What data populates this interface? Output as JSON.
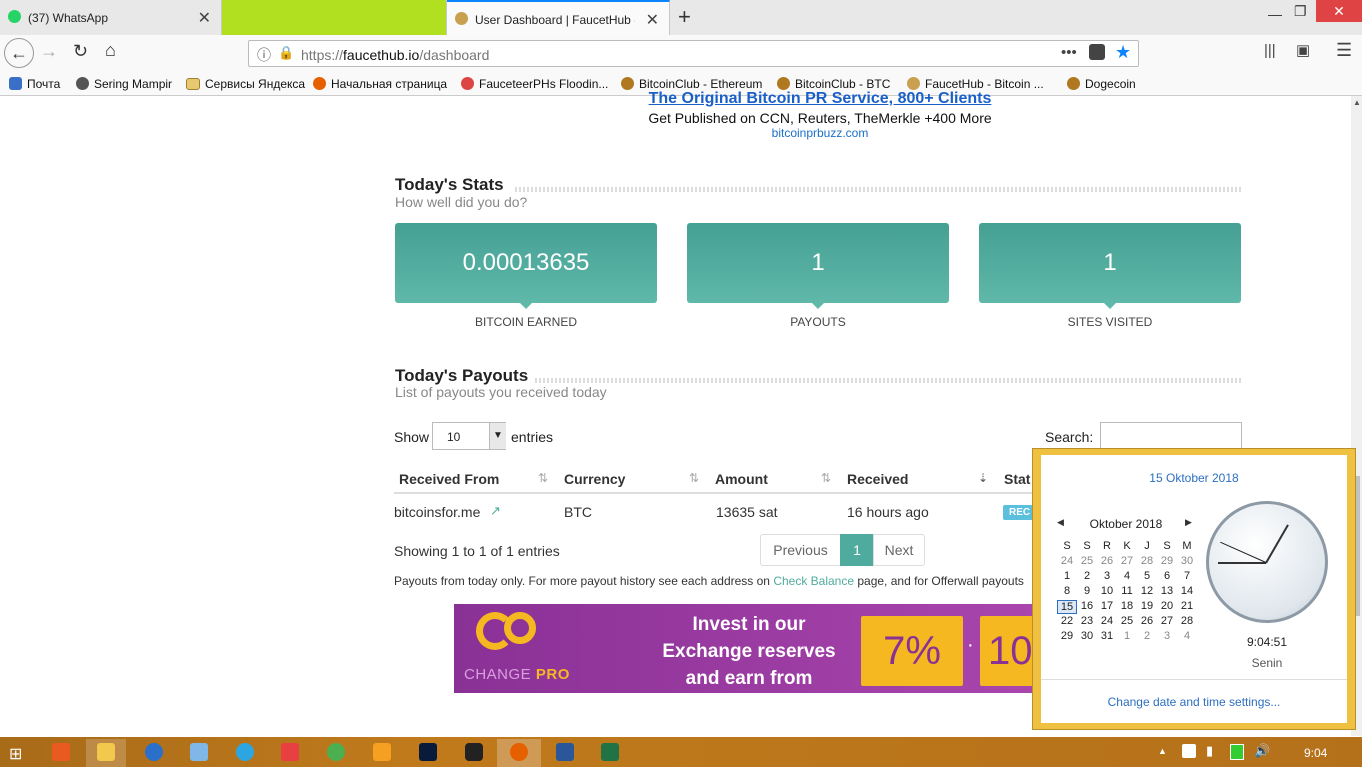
{
  "browser": {
    "tabs": [
      {
        "title": "(37) WhatsApp",
        "favicon": "whatsapp-icon",
        "badge": "37"
      },
      {
        "title": "",
        "favicon": "green-tab-icon"
      },
      {
        "title": "User Dashboard | FaucetHub - I",
        "favicon": "faucethub-icon"
      }
    ],
    "new_tab_symbol": "+",
    "url_prefix": "https://",
    "url_host": "faucethub.io",
    "url_path": "/dashboard",
    "bookmarks": [
      "Почта",
      "Sering Mampir",
      "Сервисы Яндекса",
      "Начальная страница",
      "FauceteerPHs Floodin...",
      "BitcoinClub - Ethereum",
      "BitcoinClub -  BTC",
      "FaucetHub - Bitcoin ...",
      "Dogecoin"
    ]
  },
  "ad_top": {
    "headline": "The Original Bitcoin PR Service, 800+ Clients",
    "text": "Get Published on CCN, Reuters, TheMerkle +400 More",
    "url": "bitcoinprbuzz.com"
  },
  "stats": {
    "title": "Today's Stats",
    "subtitle": "How well did you do?",
    "cards": [
      {
        "value": "0.00013635",
        "label": "BITCOIN EARNED"
      },
      {
        "value": "1",
        "label": "PAYOUTS"
      },
      {
        "value": "1",
        "label": "SITES VISITED"
      }
    ]
  },
  "payouts": {
    "title": "Today's Payouts",
    "subtitle": "List of payouts you received today",
    "show_label": "Show",
    "entries_value": "10",
    "entries_label": "entries",
    "search_label": "Search:",
    "columns": [
      "Received From",
      "Currency",
      "Amount",
      "Received",
      "Stat"
    ],
    "rows": [
      {
        "from": "bitcoinsfor.me",
        "currency": "BTC",
        "amount": "13635 sat",
        "received": "16 hours ago",
        "status": "REC"
      }
    ],
    "info": "Showing 1 to 1 of 1 entries",
    "pagination": {
      "previous": "Previous",
      "current": "1",
      "next": "Next"
    },
    "note_pre": "Payouts from today only. For more payout history see each address on ",
    "note_link": "Check Balance",
    "note_post": " page, and for Offerwall payouts"
  },
  "ad_bottom": {
    "brand_change": "CHANGE",
    "brand_pro": "PRO",
    "line1": "Invest in our",
    "line2": "Exchange reserves",
    "line3": "and earn from",
    "pct1": "7%",
    "pct2": "10"
  },
  "calendar": {
    "date_header": "15 Oktober 2018",
    "month": "Oktober 2018",
    "weekdays": [
      "S",
      "S",
      "R",
      "K",
      "J",
      "S",
      "M"
    ],
    "weeks": [
      [
        "24",
        "25",
        "26",
        "27",
        "28",
        "29",
        "30"
      ],
      [
        "1",
        "2",
        "3",
        "4",
        "5",
        "6",
        "7"
      ],
      [
        "8",
        "9",
        "10",
        "11",
        "12",
        "13",
        "14"
      ],
      [
        "15",
        "16",
        "17",
        "18",
        "19",
        "20",
        "21"
      ],
      [
        "22",
        "23",
        "24",
        "25",
        "26",
        "27",
        "28"
      ],
      [
        "29",
        "30",
        "31",
        "1",
        "2",
        "3",
        "4"
      ]
    ],
    "today": "15",
    "time": "9:04:51",
    "day_name": "Senin",
    "settings_link": "Change date and time settings..."
  },
  "taskbar": {
    "clock": "9:04"
  },
  "colors": {
    "teal": "#4fab9d",
    "accent_link": "#2c7fbf",
    "status_badge": "#5bc0de",
    "taskbar": "#b5711a",
    "ad_purple": "#9a3fa5",
    "ad_yellow": "#f6b820"
  }
}
